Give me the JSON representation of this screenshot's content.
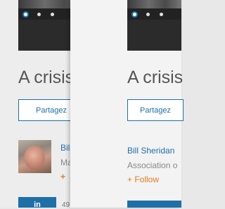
{
  "back_card": {
    "headline": "A crisis",
    "share_button": "Partagez",
    "author_name": "Bill",
    "author_org": "Ma",
    "follow_plus": "+",
    "linkedin_icon": "in",
    "share_count": "49",
    "carousel": {
      "dot_count": 3,
      "active_index": 0
    }
  },
  "front_card": {
    "headline": "A crisis",
    "share_button": "Partagez",
    "author_name": "Bill Sheridan",
    "author_org": "Association o",
    "follow_label": "+ Follow",
    "carousel": {
      "dot_count": 3,
      "active_index": 0
    }
  },
  "colors": {
    "accent_blue": "#1f6fa8",
    "follow_orange": "#e07b1e",
    "text_gray": "#555555"
  }
}
